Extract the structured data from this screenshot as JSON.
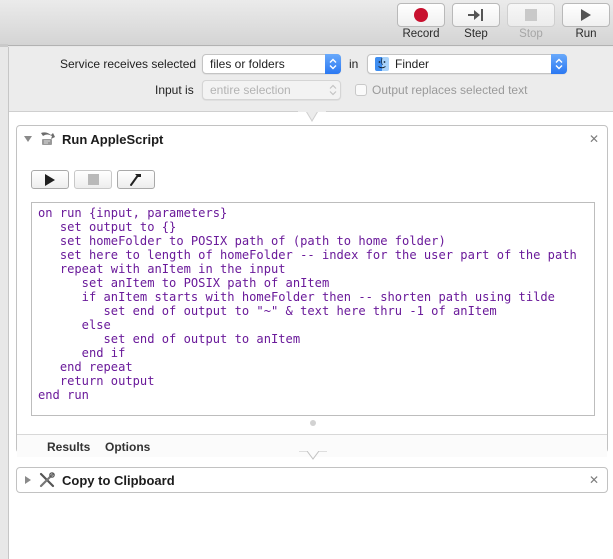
{
  "toolbar": {
    "buttons": [
      {
        "label": "Record",
        "icon": "record-icon"
      },
      {
        "label": "Step",
        "icon": "step-icon"
      },
      {
        "label": "Stop",
        "icon": "stop-icon"
      },
      {
        "label": "Run",
        "icon": "run-icon"
      }
    ]
  },
  "service": {
    "receives_label": "Service receives selected",
    "receives_value": "files or folders",
    "in_label": "in",
    "app_value": "Finder",
    "input_label": "Input is",
    "input_value": "entire selection",
    "output_replaces_label": "Output replaces selected text",
    "output_replaces_checked": false
  },
  "actions": [
    {
      "title": "Run AppleScript",
      "expanded": true,
      "script_lines": [
        "on run {input, parameters}",
        "   set output to {}",
        "   set homeFolder to POSIX path of (path to home folder)",
        "   set here to length of homeFolder -- index for the user part of the path",
        "   repeat with anItem in the input",
        "      set anItem to POSIX path of anItem",
        "      if anItem starts with homeFolder then -- shorten path using tilde",
        "         set end of output to \"~\" & text here thru -1 of anItem",
        "      else",
        "         set end of output to anItem",
        "      end if",
        "   end repeat",
        "   return output",
        "end run"
      ],
      "tabs": [
        "Results",
        "Options"
      ]
    },
    {
      "title": "Copy to Clipboard",
      "expanded": false
    }
  ],
  "colors": {
    "script_text": "#6a1a9a",
    "record_red": "#c8102e",
    "popup_blue": "#2a78f2"
  }
}
